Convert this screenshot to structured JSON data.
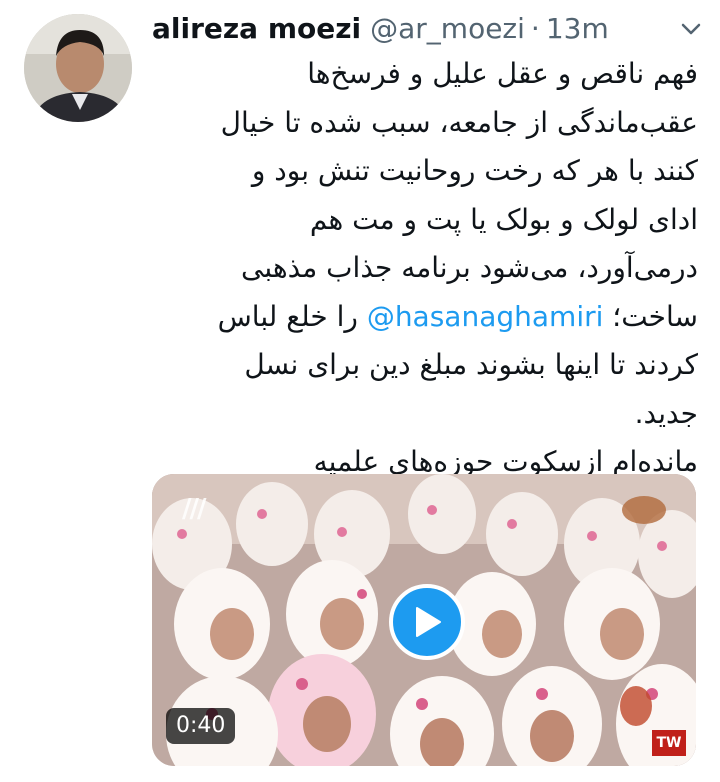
{
  "tweet": {
    "author_name": "alireza moezi",
    "handle": "@ar_moezi",
    "separator": "·",
    "timestamp": "13m",
    "text_lines": [
      "فهم ناقص و عقل علیل و فرسخ‌ها",
      "عقب‌ماندگی از جامعه، سبب شده تا خیال",
      "کنند با هر که رخت روحانیت تنش بود و",
      "ادای لولک و بولک یا پت و مت هم",
      "درمی‌آورد، می‌شود برنامه جذاب مذهبی"
    ],
    "line6_before": "ساخت؛ ",
    "mention": "@hasanaghamiri",
    "line6_after": " را خلع لباس",
    "text_lines_end": [
      "کردند تا اینها بشوند مبلغ دین برای نسل",
      "جدید.",
      "مانده‌ام ازسکوت حوزه‌های علمیه"
    ]
  },
  "media": {
    "type": "video",
    "duration": "0:40",
    "channel_logo_glyph": "///",
    "badge": "TW"
  },
  "icons": {
    "more": "more-options-icon",
    "play": "play-icon"
  },
  "colors": {
    "link": "#1d9bf0",
    "secondary_text": "#536471",
    "primary_text": "#0f1419",
    "play_button": "#1d9bf0"
  }
}
